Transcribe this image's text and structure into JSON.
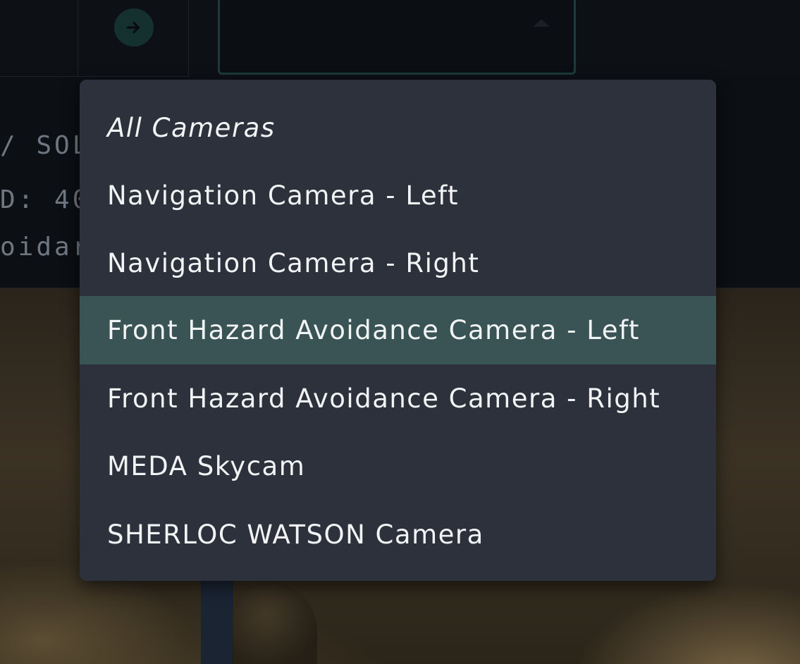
{
  "topbar": {
    "go_icon": "arrow-right-icon"
  },
  "info_panel": {
    "line1": "/ SOL",
    "line2": "D: 40",
    "line3": "oidar"
  },
  "dropdown": {
    "highlight_color": "#3a5456",
    "options": [
      {
        "label": "All Cameras",
        "italic": true
      },
      {
        "label": "Navigation Camera - Left"
      },
      {
        "label": "Navigation Camera - Right"
      },
      {
        "label": "Front Hazard Avoidance Camera - Left",
        "highlighted": true
      },
      {
        "label": "Front Hazard Avoidance Camera - Right"
      },
      {
        "label": "MEDA Skycam"
      },
      {
        "label": "SHERLOC WATSON Camera"
      }
    ]
  }
}
